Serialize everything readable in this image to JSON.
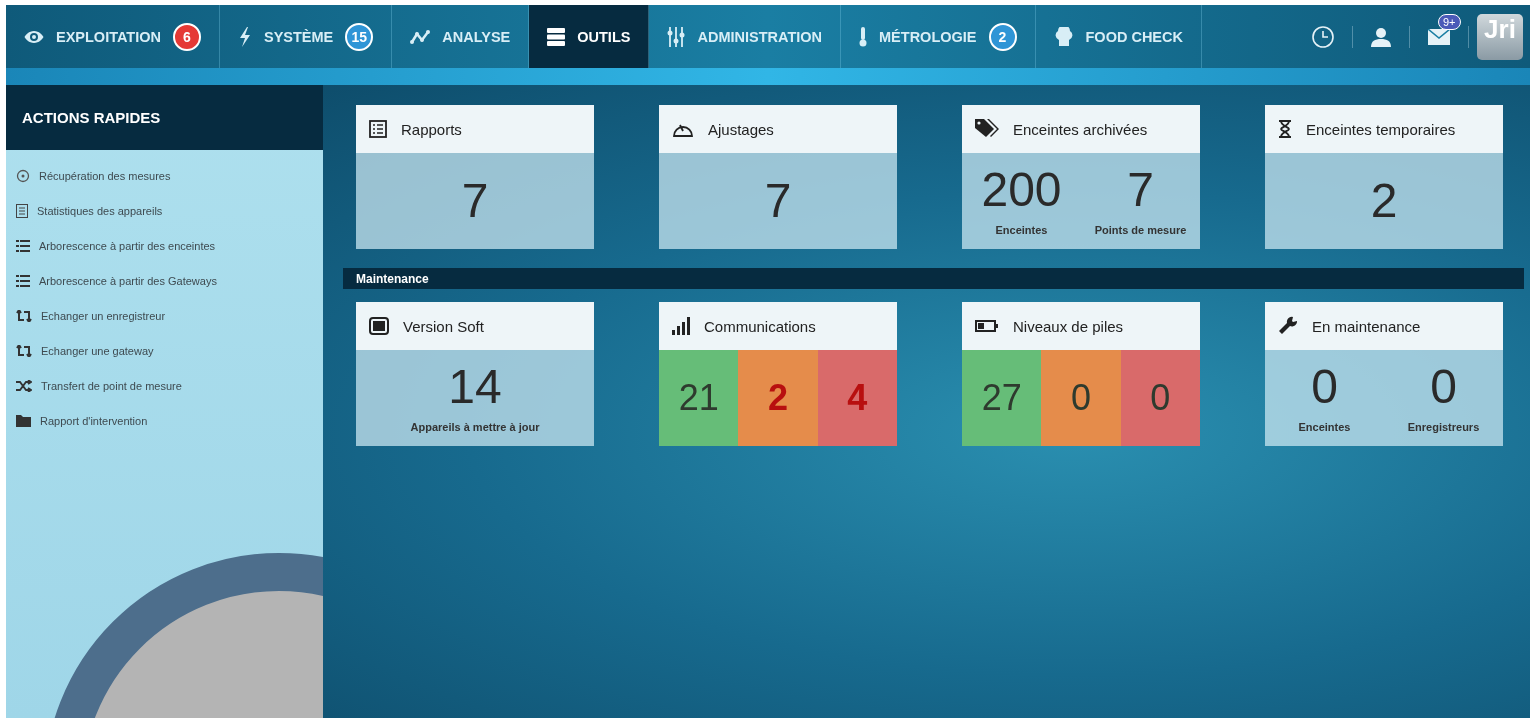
{
  "nav": {
    "tabs": [
      {
        "label": "EXPLOITATION",
        "badge": {
          "text": "6",
          "color": "#e53935"
        },
        "selected": false
      },
      {
        "label": "SYSTÈME",
        "badge": {
          "text": "15",
          "color": "#2f95d6"
        },
        "selected": false
      },
      {
        "label": "ANALYSE",
        "selected": false
      },
      {
        "label": "OUTILS",
        "selected": true
      },
      {
        "label": "ADMINISTRATION",
        "selected": false
      },
      {
        "label": "MÉTROLOGIE",
        "badge": {
          "text": "2",
          "color": "#2f95d6"
        },
        "selected": false
      },
      {
        "label": "FOOD CHECK",
        "selected": false
      }
    ],
    "mail_badge": "9+",
    "logo": "Jri"
  },
  "sidebar": {
    "title": "ACTIONS RAPIDES",
    "items": [
      "Récupération des mesures",
      "Statistiques des appareils",
      "Arborescence à partir des enceintes",
      "Arborescence à partir des Gateways",
      "Echanger un enregistreur",
      "Echanger une gateway",
      "Transfert de point de mesure",
      "Rapport d'intervention"
    ]
  },
  "top_cards": [
    {
      "kind": "single",
      "title": "Rapports",
      "value": "7"
    },
    {
      "kind": "single",
      "title": "Ajustages",
      "value": "7"
    },
    {
      "kind": "pair",
      "title": "Enceintes archivées",
      "items": [
        {
          "value": "200",
          "caption": "Enceintes"
        },
        {
          "value": "7",
          "caption": "Points de mesure"
        }
      ]
    },
    {
      "kind": "single",
      "title": "Enceintes temporaires",
      "value": "2"
    }
  ],
  "maintenance": {
    "title": "Maintenance",
    "cards": [
      {
        "kind": "single",
        "title": "Version Soft",
        "value": "14",
        "caption": "Appareils à mettre à jour"
      },
      {
        "kind": "status",
        "title": "Communications",
        "cells": [
          {
            "value": "21",
            "color": "#66bd78",
            "alert": false
          },
          {
            "value": "2",
            "color": "#e58c4b",
            "alert": true
          },
          {
            "value": "4",
            "color": "#d96a6a",
            "alert": true
          }
        ]
      },
      {
        "kind": "status",
        "title": "Niveaux de piles",
        "cells": [
          {
            "value": "27",
            "color": "#66bd78",
            "alert": false
          },
          {
            "value": "0",
            "color": "#e58c4b",
            "alert": false
          },
          {
            "value": "0",
            "color": "#d96a6a",
            "alert": false
          }
        ]
      },
      {
        "kind": "pair",
        "title": "En maintenance",
        "items": [
          {
            "value": "0",
            "caption": "Enceintes"
          },
          {
            "value": "0",
            "caption": "Enregistreurs"
          }
        ]
      }
    ]
  }
}
